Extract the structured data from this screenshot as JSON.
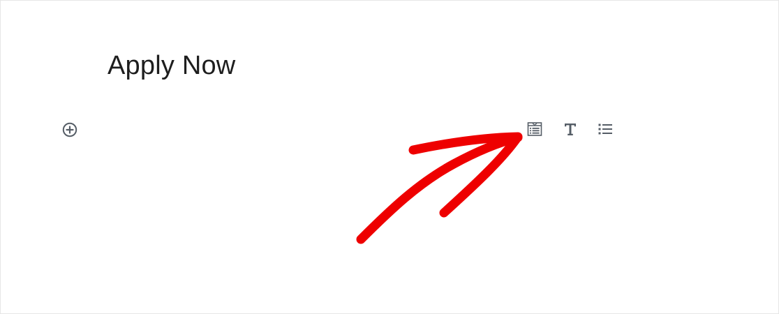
{
  "page": {
    "title": "Apply Now"
  },
  "icons": {
    "inserter": "plus-circle-icon",
    "form_block": "form-icon",
    "text_block": "text-icon",
    "list_block": "list-icon",
    "annotation": "red-hand-drawn-arrow"
  },
  "colors": {
    "icon": "#555d66",
    "title": "#1e1e1e",
    "annotation_arrow": "#ee0000",
    "background": "#ffffff"
  }
}
